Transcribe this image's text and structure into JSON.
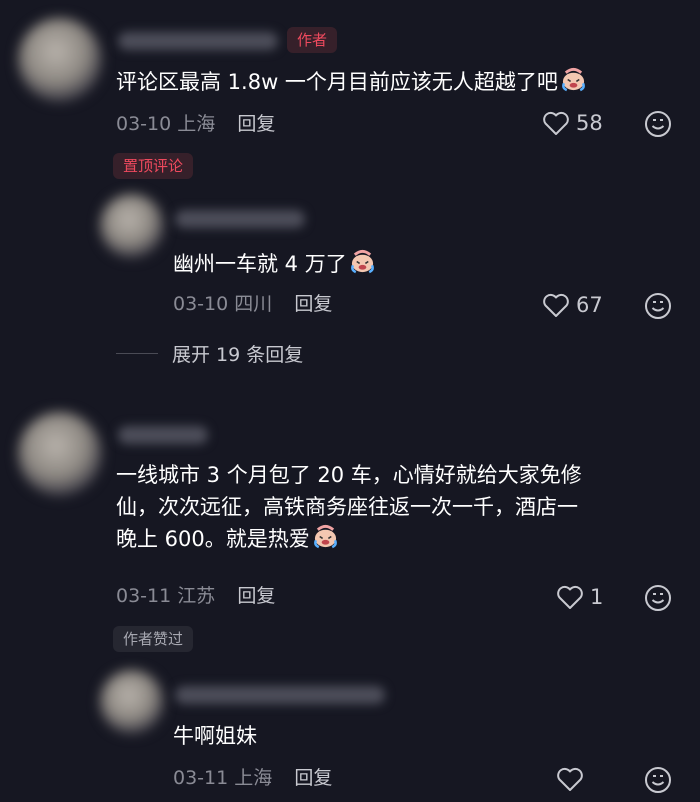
{
  "comments": [
    {
      "author_tag": "作者",
      "text": "评论区最高 1.8w 一个月目前应该无人超越了吧",
      "date": "03-10",
      "location": "上海",
      "reply_label": "回复",
      "likes": "58",
      "pinned_tag": "置顶评论"
    },
    {
      "text": "幽州一车就 4 万了",
      "date": "03-10",
      "location": "四川",
      "reply_label": "回复",
      "likes": "67",
      "expand_label": "展开 19 条回复"
    },
    {
      "lines": [
        "一线城市 3 个月包了 20 车，心情好就给大家免修",
        "仙，次次远征，高铁商务座往返一次一千，酒店一",
        "晚上 600。就是热爱"
      ],
      "date": "03-11",
      "location": "江苏",
      "reply_label": "回复",
      "likes": "1",
      "liked_tag": "作者赞过"
    },
    {
      "text": "牛啊姐妹",
      "date": "03-11",
      "location": "上海",
      "reply_label": "回复",
      "likes": ""
    }
  ],
  "icons": {
    "like": "heart-outline-icon",
    "emoji_reaction": "smile-face-icon",
    "inline_emoji": "crying-face-emoji"
  },
  "colors": {
    "background": "#161722",
    "accent": "#ef4a5e",
    "text_primary": "#ffffff",
    "text_secondary": "#8a8b95"
  }
}
